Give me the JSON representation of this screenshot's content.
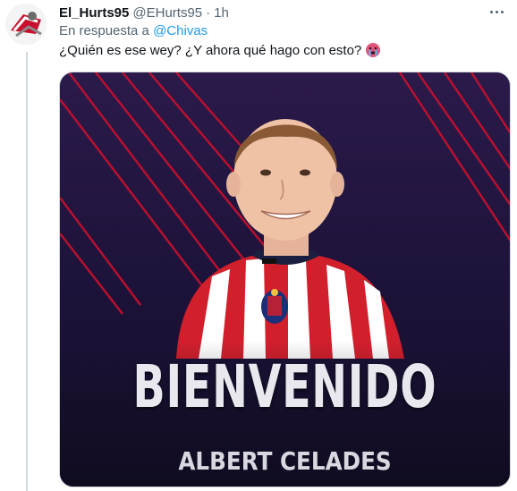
{
  "tweet": {
    "display_name": "El_Hurts95",
    "handle": "@EHurts95",
    "separator": "·",
    "time": "1h",
    "reply_prefix": "En respuesta a",
    "reply_to": "@Chivas",
    "text": "¿Quién es ese wey? ¿Y ahora qué hago con esto?",
    "emoji": "crying-face-emoji"
  },
  "media": {
    "headline": "BIENVENIDO",
    "player_name": "ALBERT CELADES",
    "colors": {
      "background": "#1c1238",
      "stripes": "#c8102e",
      "jersey_red": "#d21f2c",
      "jersey_white": "#ffffff"
    }
  }
}
